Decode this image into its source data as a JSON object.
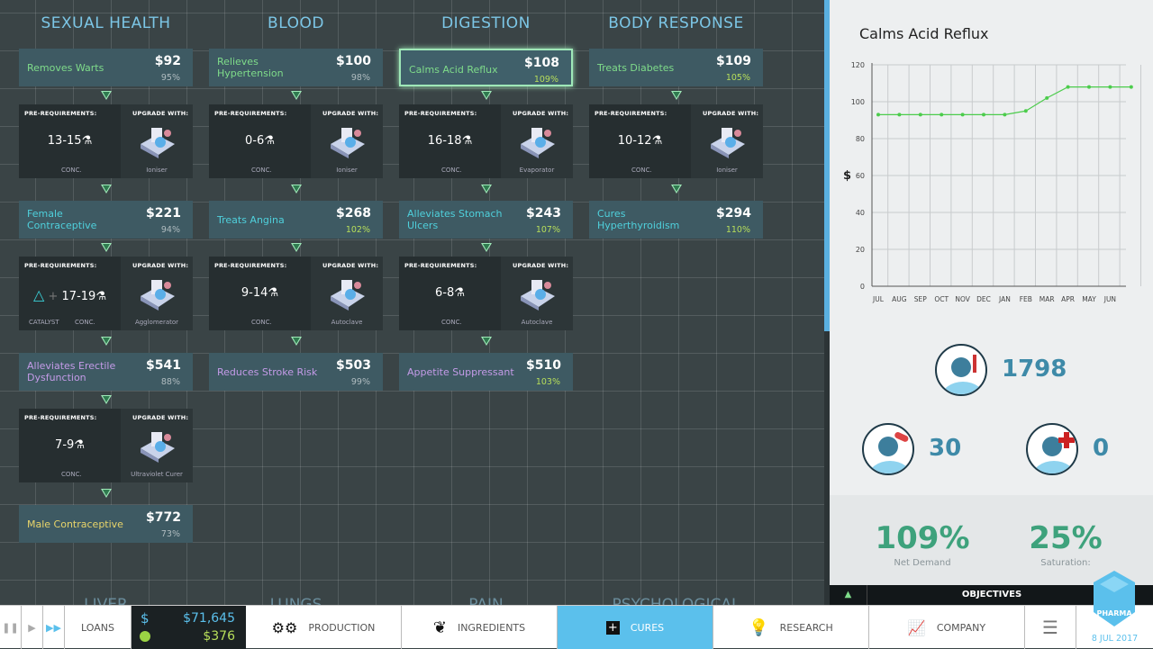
{
  "columns": [
    {
      "title": "SEXUAL HEALTH",
      "bottom": "LIVER",
      "items": [
        {
          "cure": {
            "name": "Removes Warts",
            "price": "$92",
            "percent": "95%",
            "color": "#7fdc8a",
            "up": false
          },
          "req": {
            "range": "13-15",
            "machine": "Ioniser"
          }
        },
        {
          "cure": {
            "name": "Female Contraceptive",
            "price": "$221",
            "percent": "94%",
            "color": "#4fd0dc",
            "up": false
          },
          "req": {
            "range": "17-19",
            "machine": "Agglomerator",
            "catalyst": "CATALYST"
          }
        },
        {
          "cure": {
            "name": "Alleviates Erectile Dysfunction",
            "price": "$541",
            "percent": "88%",
            "color": "#c49be8",
            "up": false
          },
          "req": {
            "range": "7-9",
            "machine": "Ultraviolet Curer"
          }
        },
        {
          "cure": {
            "name": "Male Contraceptive",
            "price": "$772",
            "percent": "73%",
            "color": "#e8d46a",
            "up": false
          }
        }
      ]
    },
    {
      "title": "BLOOD",
      "bottom": "LUNGS",
      "items": [
        {
          "cure": {
            "name": "Relieves Hypertension",
            "price": "$100",
            "percent": "98%",
            "color": "#7fdc8a",
            "up": false
          },
          "req": {
            "range": "0-6",
            "machine": "Ioniser"
          }
        },
        {
          "cure": {
            "name": "Treats Angina",
            "price": "$268",
            "percent": "102%",
            "color": "#4fd0dc",
            "up": true
          },
          "req": {
            "range": "9-14",
            "machine": "Autoclave"
          }
        },
        {
          "cure": {
            "name": "Reduces Stroke Risk",
            "price": "$503",
            "percent": "99%",
            "color": "#c49be8",
            "up": false
          }
        }
      ]
    },
    {
      "title": "DIGESTION",
      "bottom": "PAIN",
      "items": [
        {
          "cure": {
            "name": "Calms Acid Reflux",
            "price": "$108",
            "percent": "109%",
            "color": "#7fdc8a",
            "up": true,
            "selected": true
          },
          "req": {
            "range": "16-18",
            "machine": "Evaporator"
          }
        },
        {
          "cure": {
            "name": "Alleviates Stomach Ulcers",
            "price": "$243",
            "percent": "107%",
            "color": "#4fd0dc",
            "up": true
          },
          "req": {
            "range": "6-8",
            "machine": "Autoclave"
          }
        },
        {
          "cure": {
            "name": "Appetite Suppressant",
            "price": "$510",
            "percent": "103%",
            "color": "#c49be8",
            "up": true
          }
        }
      ]
    },
    {
      "title": "BODY RESPONSE",
      "bottom": "PSYCHOLOGICAL",
      "items": [
        {
          "cure": {
            "name": "Treats Diabetes",
            "price": "$109",
            "percent": "105%",
            "color": "#7fdc8a",
            "up": true
          },
          "req": {
            "range": "10-12",
            "machine": "Ioniser"
          }
        },
        {
          "cure": {
            "name": "Cures Hyperthyroidism",
            "price": "$294",
            "percent": "110%",
            "color": "#4fd0dc",
            "up": true
          }
        }
      ]
    }
  ],
  "labels": {
    "prereq": "PRE-REQUIREMENTS:",
    "upgrade": "UPGRADE WITH:",
    "conc": "CONC.",
    "flask": "⚗"
  },
  "panel": {
    "title": "Calms Acid Reflux",
    "patients": "1798",
    "treated": "30",
    "cured": "0",
    "net_demand": "109%",
    "net_demand_label": "Net Demand",
    "saturation": "25%",
    "saturation_label": "Saturation:",
    "objectives": "OBJECTIVES"
  },
  "chart_data": {
    "type": "line",
    "ylabel": "$",
    "ylim": [
      0,
      120
    ],
    "yticks": [
      0,
      20,
      40,
      60,
      80,
      100,
      120
    ],
    "categories": [
      "JUL",
      "AUG",
      "SEP",
      "OCT",
      "NOV",
      "DEC",
      "JAN",
      "FEB",
      "MAR",
      "APR",
      "MAY",
      "JUN"
    ],
    "values": [
      93,
      93,
      93,
      93,
      93,
      93,
      93,
      95,
      102,
      108,
      108,
      108,
      108
    ],
    "color": "#4ccc4c",
    "grid": true
  },
  "bottombar": {
    "loans": "LOANS",
    "money_symbol": "$",
    "money": "$71,645",
    "income": "$376",
    "production": "PRODUCTION",
    "ingredients": "INGREDIENTS",
    "cures": "CURES",
    "research": "RESEARCH",
    "company": "COMPANY",
    "date": "8 JUL 2017",
    "logo": "BIG PHARMA",
    "accent": "#5bc0ec"
  }
}
